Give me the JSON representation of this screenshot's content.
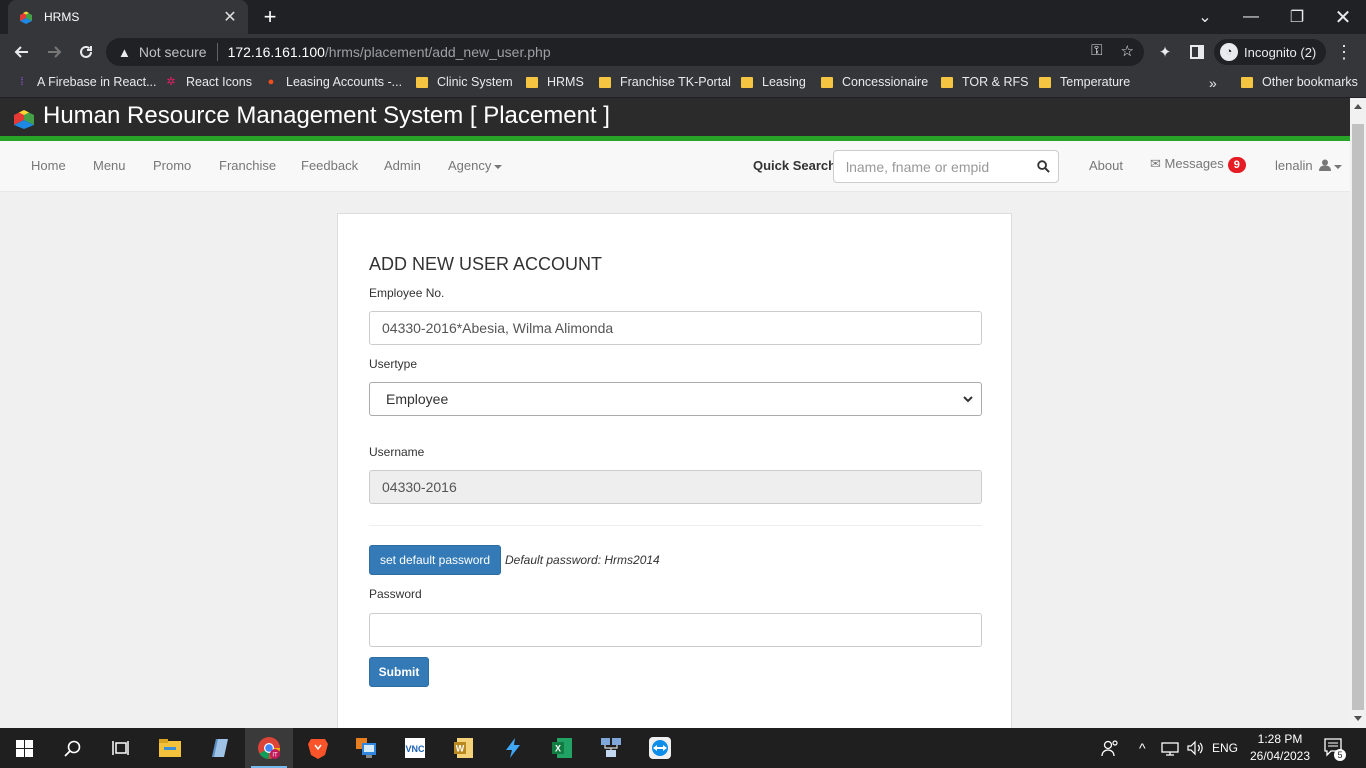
{
  "browser": {
    "tab_title": "HRMS",
    "new_tab": "+",
    "url_warning": "Not secure",
    "url_host": "172.16.161.100",
    "url_path": "/hrms/placement/add_new_user.php",
    "incognito_label": "Incognito (2)",
    "bookmarks": [
      {
        "label": "A Firebase in React...",
        "icon": "firebase-icon"
      },
      {
        "label": "React Icons",
        "icon": "react-icon"
      },
      {
        "label": "Leasing Accounts -...",
        "icon": "figma-icon"
      },
      {
        "label": "Clinic System",
        "icon": "folder-icon"
      },
      {
        "label": "HRMS",
        "icon": "folder-icon"
      },
      {
        "label": "Franchise TK-Portal",
        "icon": "folder-icon"
      },
      {
        "label": "Leasing",
        "icon": "folder-icon"
      },
      {
        "label": "Concessionaire",
        "icon": "folder-icon"
      },
      {
        "label": "TOR & RFS",
        "icon": "folder-icon"
      },
      {
        "label": "Temperature",
        "icon": "folder-icon"
      }
    ],
    "bookmarks_overflow": "»",
    "other_bookmarks": "Other bookmarks"
  },
  "app": {
    "title": "Human Resource Management System [ Placement ]",
    "nav": {
      "home": "Home",
      "menu": "Menu",
      "promo": "Promo",
      "franchise": "Franchise",
      "feedback": "Feedback",
      "admin": "Admin",
      "agency": "Agency",
      "quick_search_label": "Quick Search",
      "quick_search_placeholder": "lname, fname or empid",
      "about": "About",
      "messages": "Messages",
      "messages_count": "9",
      "user": "lenalin"
    },
    "form": {
      "title": "ADD NEW USER ACCOUNT",
      "employee_label": "Employee No.",
      "employee_value": "04330-2016*Abesia, Wilma Alimonda",
      "usertype_label": "Usertype",
      "usertype_value": "Employee",
      "username_label": "Username",
      "username_value": "04330-2016",
      "set_default_button": "set default password",
      "default_hint": "Default password: Hrms2014",
      "password_label": "Password",
      "password_value": "",
      "submit_button": "Submit"
    }
  },
  "taskbar": {
    "language": "ENG",
    "time": "1:28 PM",
    "date": "26/04/2023",
    "notification_count": "5"
  },
  "colors": {
    "accent_green": "#27a327",
    "primary_blue": "#337ab7",
    "badge_red": "#e51c23"
  }
}
